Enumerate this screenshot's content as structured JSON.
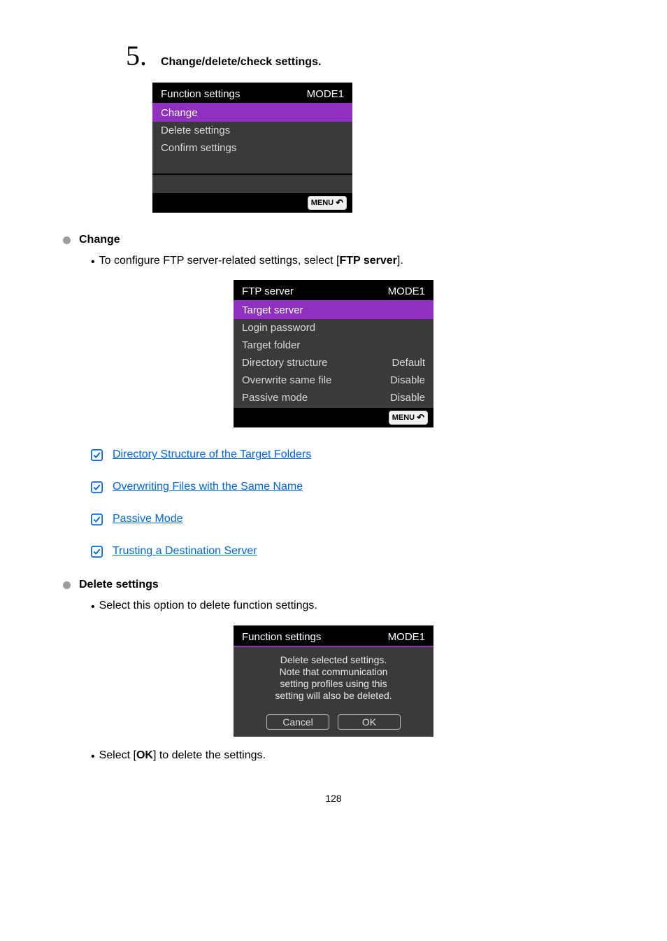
{
  "step": {
    "num": "5.",
    "title": "Change/delete/check settings."
  },
  "ss1": {
    "title": "Function settings",
    "mode": "MODE1",
    "rows": [
      "Change",
      "Delete settings",
      "Confirm settings"
    ]
  },
  "change": {
    "heading": "Change",
    "bullet_pre": "To configure FTP server-related settings, select [",
    "bullet_bold": "FTP server",
    "bullet_post": "]."
  },
  "ss2": {
    "title": "FTP server",
    "mode": "MODE1",
    "rows": [
      {
        "label": "Target server",
        "val": ""
      },
      {
        "label": "Login password",
        "val": ""
      },
      {
        "label": "Target folder",
        "val": ""
      },
      {
        "label": "Directory structure",
        "val": "Default"
      },
      {
        "label": "Overwrite same file",
        "val": "Disable"
      },
      {
        "label": "Passive mode",
        "val": "Disable"
      }
    ]
  },
  "links": {
    "l1": "Directory Structure of the Target Folders",
    "l2": "Overwriting Files with the Same Name",
    "l3": "Passive Mode",
    "l4": "Trusting a Destination Server"
  },
  "delete": {
    "heading": "Delete settings",
    "bullet": "Select this option to delete function settings."
  },
  "dialog": {
    "title": "Function settings",
    "mode": "MODE1",
    "lines": [
      "Delete selected settings.",
      "Note that communication",
      "setting profiles using this",
      "setting will also be deleted."
    ],
    "cancel": "Cancel",
    "ok": "OK"
  },
  "final": {
    "pre": "Select [",
    "bold": "OK",
    "post": "] to delete the settings."
  },
  "menu_label": "MENU",
  "page": "128"
}
